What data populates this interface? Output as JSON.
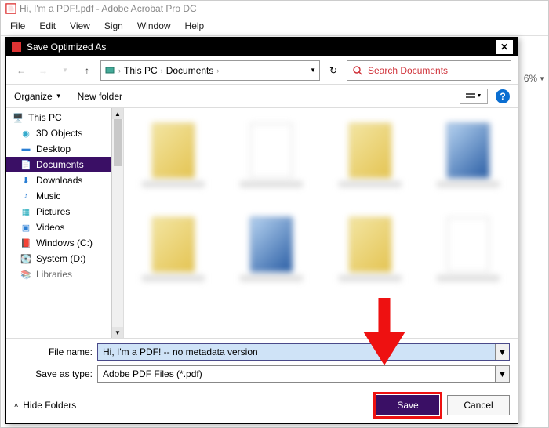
{
  "app": {
    "title": "Hi, I'm a PDF!.pdf - Adobe Acrobat Pro DC",
    "zoom": "6%"
  },
  "menu": {
    "file": "File",
    "edit": "Edit",
    "view": "View",
    "sign": "Sign",
    "window": "Window",
    "help": "Help"
  },
  "dialog": {
    "title": "Save Optimized As",
    "breadcrumb": {
      "root": "This PC",
      "folder": "Documents"
    },
    "search_placeholder": "Search Documents",
    "organize": "Organize",
    "new_folder": "New folder",
    "tree": {
      "this_pc": "This PC",
      "objects3d": "3D Objects",
      "desktop": "Desktop",
      "documents": "Documents",
      "downloads": "Downloads",
      "music": "Music",
      "pictures": "Pictures",
      "videos": "Videos",
      "windows_c": "Windows (C:)",
      "system_d": "System (D:)",
      "libraries": "Libraries"
    },
    "file_name_label": "File name:",
    "file_name_value": "Hi, I'm a PDF! -- no metadata version",
    "save_as_type_label": "Save as type:",
    "save_as_type_value": "Adobe PDF Files (*.pdf)",
    "hide_folders": "Hide Folders",
    "save": "Save",
    "cancel": "Cancel"
  }
}
